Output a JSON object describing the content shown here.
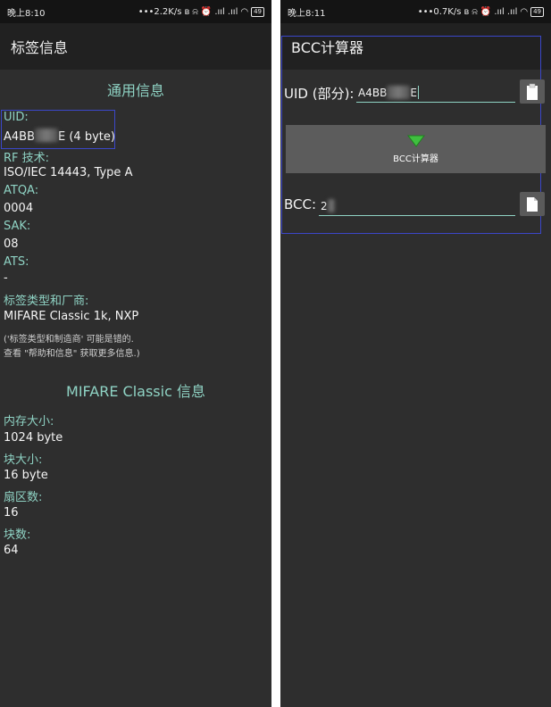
{
  "left": {
    "status": {
      "time": "晚上8:10",
      "speed": "2.2K/s",
      "battery": "49"
    },
    "title": "标签信息",
    "general_section": "通用信息",
    "uid_label": "UID:",
    "uid_prefix": "A4BB",
    "uid_suffix": "E (4 byte)",
    "rf_label": "RF 技术:",
    "rf_value": "ISO/IEC 14443, Type A",
    "atqa_label": "ATQA:",
    "atqa_value": "0004",
    "sak_label": "SAK:",
    "sak_value": "08",
    "ats_label": "ATS:",
    "ats_value": "-",
    "tagtype_label": "标签类型和厂商:",
    "tagtype_value": "MIFARE Classic 1k, NXP",
    "note_line1": "('标签类型和制造商' 可能是错的.",
    "note_line2": "查看 \"帮助和信息\" 获取更多信息.)",
    "mifare_section": "MIFARE Classic 信息",
    "memory_label": "内存大小:",
    "memory_value": "1024 byte",
    "block_size_label": "块大小:",
    "block_size_value": "16 byte",
    "sector_count_label": "扇区数:",
    "sector_count_value": "16",
    "block_count_label": "块数:",
    "block_count_value": "64"
  },
  "right": {
    "status": {
      "time": "晚上8:11",
      "speed": "0.7K/s",
      "battery": "49"
    },
    "title": "BCC计算器",
    "uid_label": "UID (部分):",
    "uid_prefix": "A4BB",
    "uid_suffix": "E",
    "calc_button": "BCC计算器",
    "bcc_label": "BCC:",
    "bcc_value": "2"
  },
  "colors": {
    "accent": "#8fd3c4",
    "highlight": "#3b47c9",
    "background": "#2e2e2e"
  }
}
